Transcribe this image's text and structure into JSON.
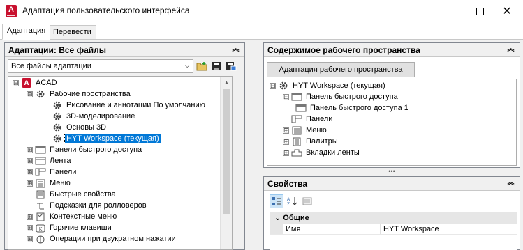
{
  "window": {
    "app_icon_letter": "A",
    "title": "Адаптация пользовательского интерфейса",
    "maximize_icon": "maximize-icon",
    "close_glyph": "✕"
  },
  "tabs": [
    {
      "label": "Адаптация",
      "active": true
    },
    {
      "label": "Перевести",
      "active": false
    }
  ],
  "left_panel": {
    "header": "Адаптации: Все файлы",
    "collapse_glyph": "︽",
    "filter": {
      "value": "Все файлы адаптации",
      "arrow": "⌵"
    },
    "toolbar": [
      "open-file-icon",
      "save-icon",
      "save-as-icon"
    ],
    "tree": [
      {
        "label": "ACAD",
        "depth": 0,
        "expander": "⊟",
        "icon": "acad-icon"
      },
      {
        "label": "Рабочие пространства",
        "depth": 1,
        "expander": "⊟",
        "icon": "gear-icon"
      },
      {
        "label": "Рисование и аннотации По умолчанию",
        "depth": 2,
        "expander": "",
        "icon": "gear-icon"
      },
      {
        "label": "3D-моделирование",
        "depth": 2,
        "expander": "",
        "icon": "gear-icon"
      },
      {
        "label": "Основы 3D",
        "depth": 2,
        "expander": "",
        "icon": "gear-icon"
      },
      {
        "label": "HYT Workspace (текущая)",
        "depth": 2,
        "expander": "",
        "icon": "gear-icon",
        "selected": true
      },
      {
        "label": "Панели быстрого доступа",
        "depth": 1,
        "expander": "⊞",
        "icon": "quick-access-icon"
      },
      {
        "label": "Лента",
        "depth": 1,
        "expander": "⊞",
        "icon": "ribbon-icon"
      },
      {
        "label": "Панели",
        "depth": 1,
        "expander": "⊞",
        "icon": "toolbar-icon"
      },
      {
        "label": "Меню",
        "depth": 1,
        "expander": "⊞",
        "icon": "menu-icon"
      },
      {
        "label": "Быстрые свойства",
        "depth": 1,
        "expander": "",
        "icon": "quick-properties-icon"
      },
      {
        "label": "Подсказки для ролловеров",
        "depth": 1,
        "expander": "",
        "icon": "rollover-icon"
      },
      {
        "label": "Контекстные меню",
        "depth": 1,
        "expander": "⊞",
        "icon": "context-menu-icon"
      },
      {
        "label": "Горячие клавиши",
        "depth": 1,
        "expander": "⊞",
        "icon": "keyboard-icon"
      },
      {
        "label": "Операции при двукратном нажатии",
        "depth": 1,
        "expander": "⊞",
        "icon": "double-click-icon"
      }
    ]
  },
  "right_top": {
    "header": "Содержимое рабочего пространства",
    "collapse_glyph": "︽",
    "button": "Адаптация рабочего пространства",
    "tree": [
      {
        "label": "HYT Workspace (текущая)",
        "depth": 0,
        "expander": "⊟",
        "icon": "gear-icon"
      },
      {
        "label": "Панель быстрого доступа",
        "depth": 1,
        "expander": "⊟",
        "icon": "quick-access-icon"
      },
      {
        "label": "Панель быстрого доступа 1",
        "depth": 2,
        "expander": "",
        "icon": "quick-access-icon"
      },
      {
        "label": "Панели",
        "depth": 1,
        "expander": "",
        "icon": "toolbar-icon"
      },
      {
        "label": "Меню",
        "depth": 1,
        "expander": "⊞",
        "icon": "menu-icon"
      },
      {
        "label": "Палитры",
        "depth": 1,
        "expander": "⊞",
        "icon": "palette-icon"
      },
      {
        "label": "Вкладки ленты",
        "depth": 1,
        "expander": "⊞",
        "icon": "ribbon-tabs-icon"
      }
    ]
  },
  "splitter_glyph": "•••",
  "properties": {
    "header": "Свойства",
    "collapse_glyph": "︽",
    "toolbar": [
      "categorized-icon",
      "alphabetical-icon",
      "property-pages-icon"
    ],
    "category": "Общие",
    "category_glyph": "⌄",
    "rows": [
      {
        "key": "Имя",
        "value": "HYT Workspace"
      }
    ]
  }
}
